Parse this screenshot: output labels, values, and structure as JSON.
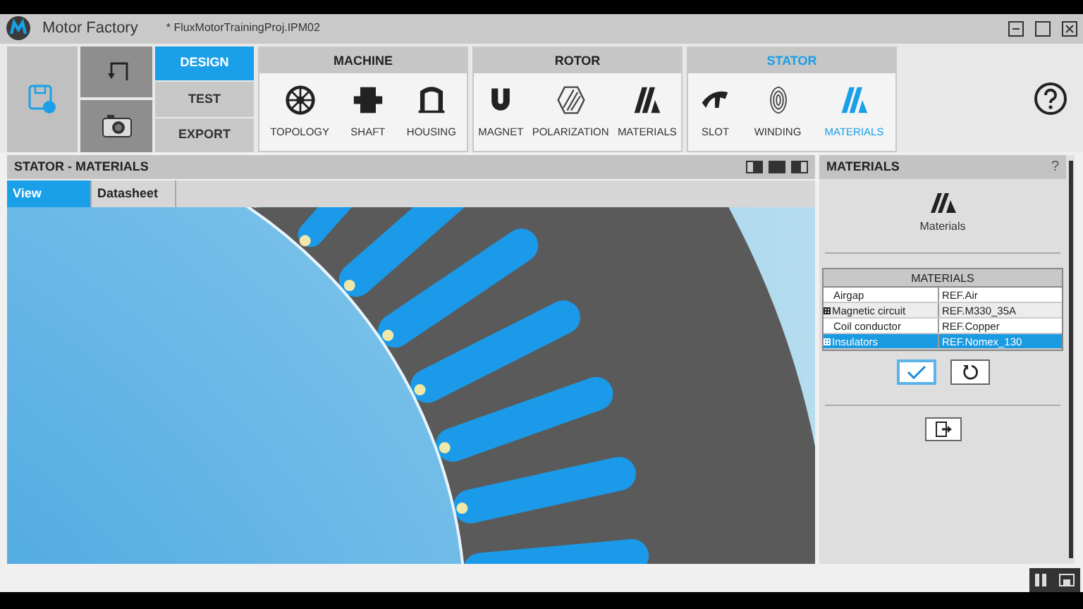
{
  "title_bar": {
    "app_name": "Motor Factory",
    "document": "* FluxMotorTrainingProj.IPM02"
  },
  "modes": [
    {
      "label": "DESIGN",
      "selected": true
    },
    {
      "label": "TEST",
      "selected": false
    },
    {
      "label": "EXPORT",
      "selected": false
    }
  ],
  "groups": [
    {
      "title": "MACHINE",
      "selected": false,
      "items": [
        {
          "label": "TOPOLOGY",
          "kind": "topology",
          "selected": false
        },
        {
          "label": "SHAFT",
          "kind": "shaft",
          "selected": false
        },
        {
          "label": "HOUSING",
          "kind": "housing",
          "selected": false
        }
      ]
    },
    {
      "title": "ROTOR",
      "selected": false,
      "items": [
        {
          "label": "MAGNET",
          "kind": "magnet",
          "selected": false
        },
        {
          "label": "POLARIZATION",
          "kind": "polarization",
          "selected": false
        },
        {
          "label": "MATERIALS",
          "kind": "materials",
          "selected": false
        }
      ]
    },
    {
      "title": "STATOR",
      "selected": true,
      "items": [
        {
          "label": "SLOT",
          "kind": "slot",
          "selected": false
        },
        {
          "label": "WINDING",
          "kind": "winding",
          "selected": false
        },
        {
          "label": "MATERIALS",
          "kind": "materials",
          "selected": true
        }
      ]
    }
  ],
  "view_panel": {
    "title": "STATOR - MATERIALS",
    "tabs": [
      {
        "label": "View",
        "selected": true
      },
      {
        "label": "Datasheet",
        "selected": false
      }
    ]
  },
  "side_panel": {
    "title": "MATERIALS",
    "help": "?",
    "icon_label": "Materials",
    "table": {
      "heading": "MATERIALS",
      "rows": [
        {
          "name": "Airgap",
          "value": "REF.Air",
          "expandable": false,
          "selected": false
        },
        {
          "name": "Magnetic circuit",
          "value": "REF.M330_35A",
          "expandable": true,
          "selected": false
        },
        {
          "name": "Coil conductor",
          "value": "REF.Copper",
          "expandable": false,
          "selected": false
        },
        {
          "name": "Insulators",
          "value": "REF.Nomex_130",
          "expandable": true,
          "selected": true
        }
      ]
    }
  }
}
